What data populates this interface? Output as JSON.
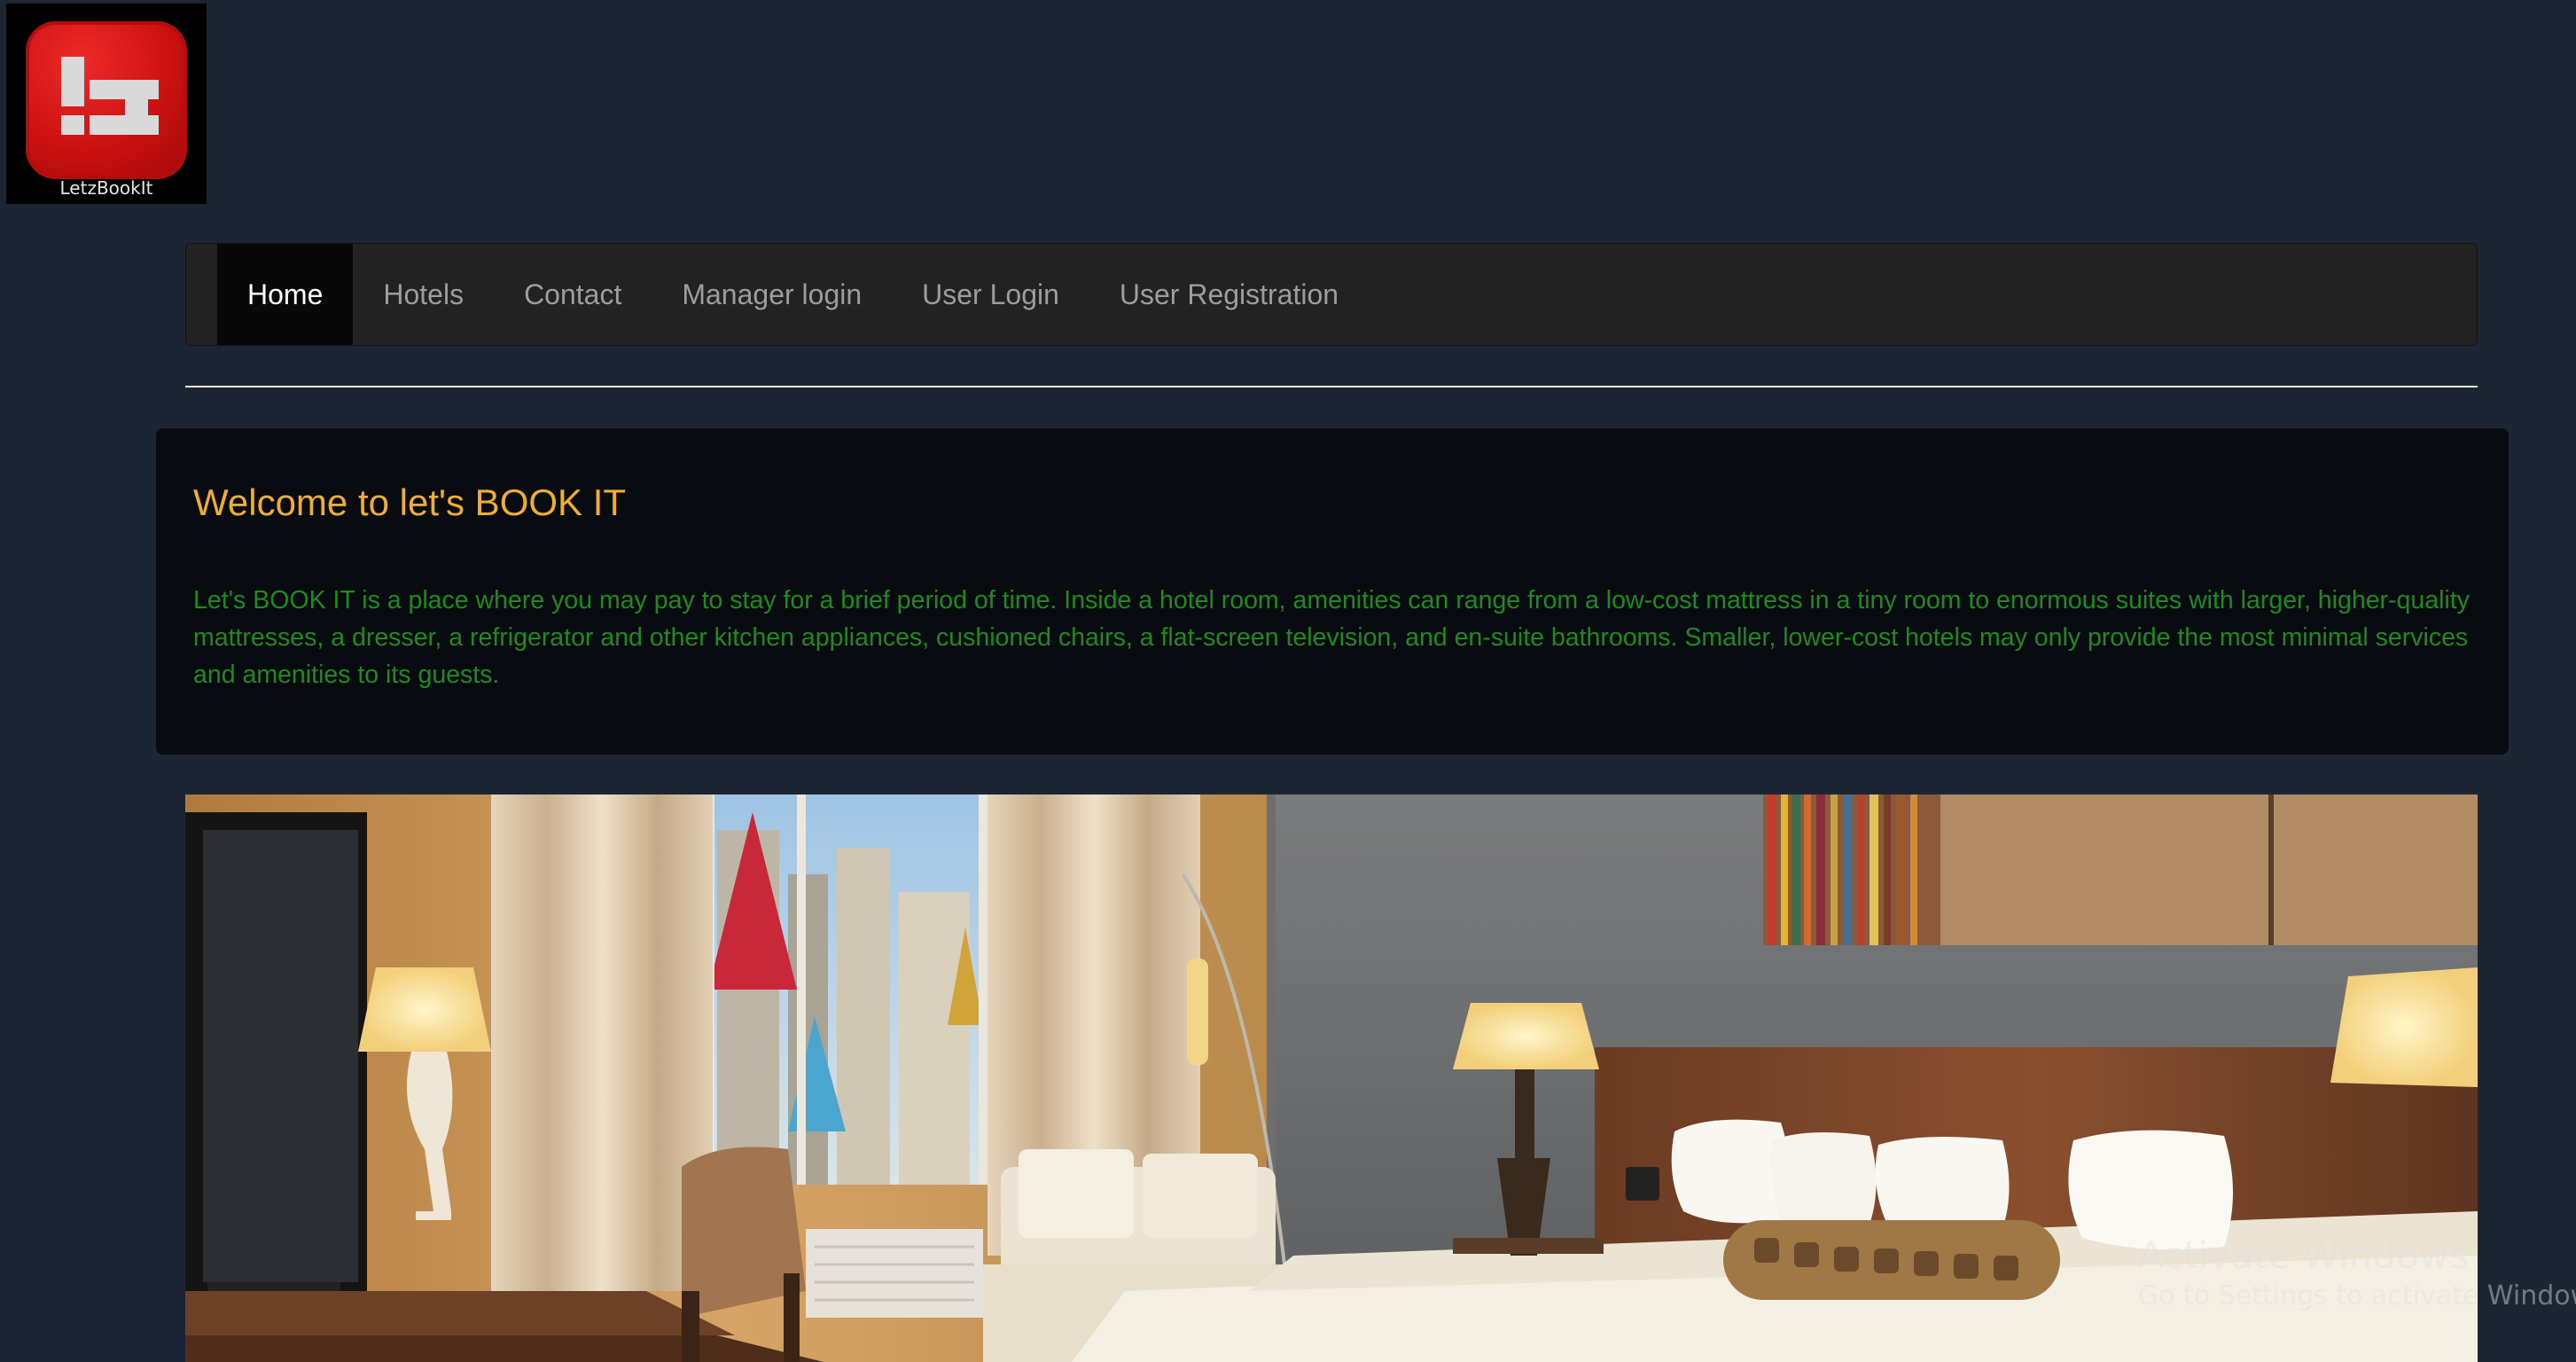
{
  "logo": {
    "caption": "LetzBookIt",
    "icon": "lz-logo-icon"
  },
  "nav": {
    "items": [
      {
        "label": "Home",
        "active": true
      },
      {
        "label": "Hotels",
        "active": false
      },
      {
        "label": "Contact",
        "active": false
      },
      {
        "label": "Manager login",
        "active": false
      },
      {
        "label": "User Login",
        "active": false
      },
      {
        "label": "User Registration",
        "active": false
      }
    ]
  },
  "jumbotron": {
    "title": "Welcome to let's BOOK IT",
    "text": "Let's BOOK IT is a place where you may pay to stay for a brief period of time. Inside a hotel room, amenities can range from a low-cost mattress in a tiny room to enormous suites with larger, higher-quality mattresses, a dresser, a refrigerator and other kitchen appliances, cushioned chairs, a flat-screen television, and en-suite bathrooms. Smaller, lower-cost hotels may only provide the most minimal services and amenities to its guests."
  },
  "hero": {
    "image": "hotel-room-photo"
  },
  "watermark": {
    "title": "Activate Windows",
    "subtitle": "Go to Settings to activate Windows."
  },
  "colors": {
    "page_bg": "#1b2533",
    "navbar_bg": "#222222",
    "title": "#f0ad31",
    "body_text": "#1f8a1f",
    "logo_red": "#cc1111"
  }
}
